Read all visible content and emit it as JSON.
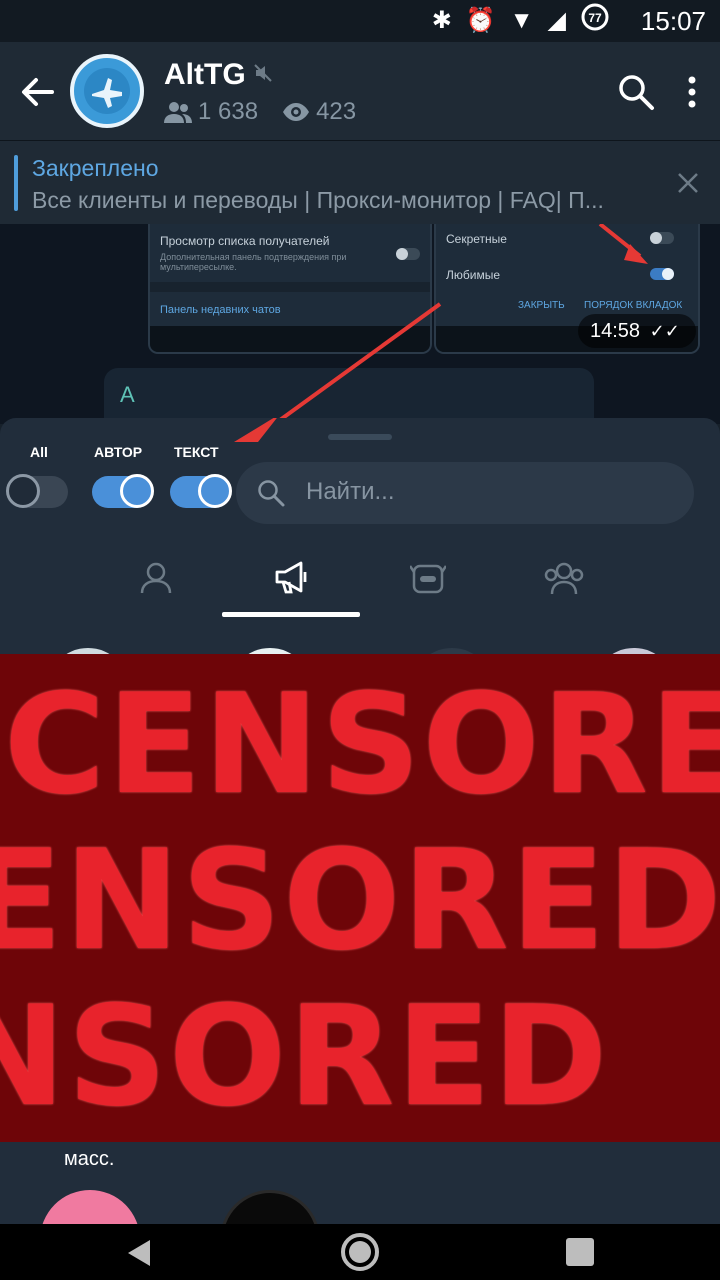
{
  "status_bar": {
    "time": "15:07",
    "icons": [
      "bluetooth-icon",
      "alarm-icon",
      "wifi-icon",
      "signal-icon",
      "battery-icon"
    ],
    "battery_level": "77"
  },
  "toolbar": {
    "channel_name": "AltTG",
    "subscribers": "1 638",
    "online": "423"
  },
  "pinned": {
    "title": "Закреплено",
    "text": "Все клиенты и переводы | Прокси-монитор | FAQ| П..."
  },
  "chat": {
    "left_screenshot": {
      "row1": "Просмотр списка получателей",
      "row1_sub": "Дополнительная панель подтверждения при мультипересылке.",
      "row2": "Панель недавних чатов"
    },
    "right_screenshot": {
      "row1": "Секретные",
      "row2": "Любимые",
      "button1": "ЗАКРЫТЬ",
      "button2": "ПОРЯДОК ВКЛАДОК"
    },
    "message_time": "14:58",
    "bubble_letter": "A"
  },
  "sheet": {
    "filters": [
      {
        "label": "All",
        "on": false
      },
      {
        "label": "АВТОР",
        "on": true
      },
      {
        "label": "ТЕКСТ",
        "on": true
      }
    ],
    "search_placeholder": "Найти...",
    "tabs": [
      "user-icon",
      "megaphone-icon",
      "bot-icon",
      "group-icon"
    ],
    "active_tab": 1,
    "caption": "масс."
  },
  "censor": {
    "lines": [
      "CENSORE",
      "ENSORED",
      "NSORED"
    ]
  },
  "colors": {
    "accent": "#4a90d9",
    "sheet_bg": "#212d3b",
    "censor_bg": "#6e0508",
    "censor_text": "#e8232c"
  }
}
